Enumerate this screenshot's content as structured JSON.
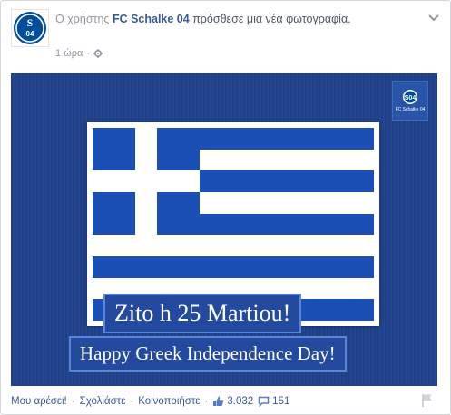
{
  "post": {
    "prefix": "Ο χρήστης",
    "author": "FC Schalke 04",
    "action": "πρόσθεσε μια νέα φωτογραφία.",
    "time": "1 ώρα",
    "privacy_icon": "gear-icon"
  },
  "photo": {
    "badge_text": "FC Schalke 04",
    "line1": "Zito h 25 Martiou!",
    "line2": "Happy Greek Independence Day!"
  },
  "footer": {
    "like": "Μου αρέσει!",
    "comment": "Σχολιάστε",
    "share": "Κοινοποιήστε",
    "likes_count": "3.032",
    "comments_count": "151"
  },
  "colors": {
    "link": "#3b5998",
    "meta": "#9197a3",
    "photo_bg": "#1f3f86",
    "flag_blue": "#1a4fb5",
    "schalke_blue": "#004d9d"
  }
}
